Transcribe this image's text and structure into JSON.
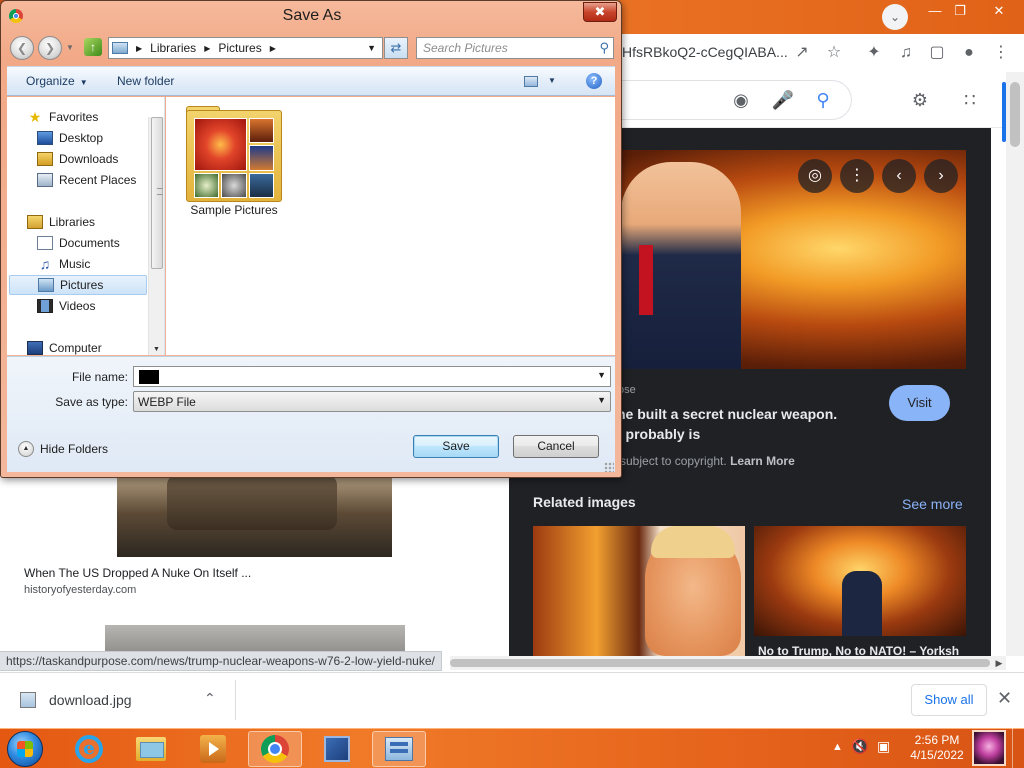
{
  "browser": {
    "url_fragment": "HfsRBkoQ2-cCegQIABA...",
    "status_url": "https://taskandpurpose.com/news/trump-nuclear-weapons-w76-2-low-yield-nuke/",
    "results": [
      {
        "title": "When The US Dropped A Nuke On Itself ...",
        "source": "historyofyesterday.com"
      }
    ],
    "preview": {
      "source_fragment": "ose",
      "caption_line1": "he built a secret nuclear weapon.",
      "caption_line2": "t probably is",
      "copyright_text": "subject to copyright.",
      "learn_more": "Learn More",
      "visit_label": "Visit",
      "related_title": "Related images",
      "see_more": "See more",
      "related_caption": "No to Trump, No to NATO! – Yorksh"
    }
  },
  "download_bar": {
    "filename": "download.jpg",
    "show_all": "Show all"
  },
  "dialog": {
    "title": "Save As",
    "breadcrumb": [
      "Libraries",
      "Pictures"
    ],
    "search_placeholder": "Search Pictures",
    "organize_label": "Organize",
    "new_folder_label": "New folder",
    "nav_items": [
      {
        "label": "Favorites",
        "icon": "star-icon"
      },
      {
        "label": "Desktop",
        "icon": "desktop-icon"
      },
      {
        "label": "Downloads",
        "icon": "downloads-icon"
      },
      {
        "label": "Recent Places",
        "icon": "recent-places-icon"
      },
      {
        "label": "Libraries",
        "icon": "libraries-icon"
      },
      {
        "label": "Documents",
        "icon": "documents-icon"
      },
      {
        "label": "Music",
        "icon": "music-icon"
      },
      {
        "label": "Pictures",
        "icon": "pictures-icon",
        "selected": true
      },
      {
        "label": "Videos",
        "icon": "videos-icon"
      },
      {
        "label": "Computer",
        "icon": "computer-icon"
      }
    ],
    "folder_name": "Sample Pictures",
    "file_name_label": "File name:",
    "file_name_value": "",
    "save_type_label": "Save as type:",
    "save_type_value": "WEBP File",
    "hide_folders_label": "Hide Folders",
    "save_label": "Save",
    "cancel_label": "Cancel"
  },
  "taskbar": {
    "apps": [
      "internet-explorer",
      "windows-explorer",
      "media-player",
      "chrome",
      "virtualbox",
      "control-panel"
    ],
    "time": "2:56 PM",
    "date": "4/15/2022"
  },
  "colors": {
    "taskbar": "#e86a1f",
    "dialog_frame": "#f3b09a",
    "preview_bg": "#202124",
    "link_blue": "#8ab4f8"
  }
}
